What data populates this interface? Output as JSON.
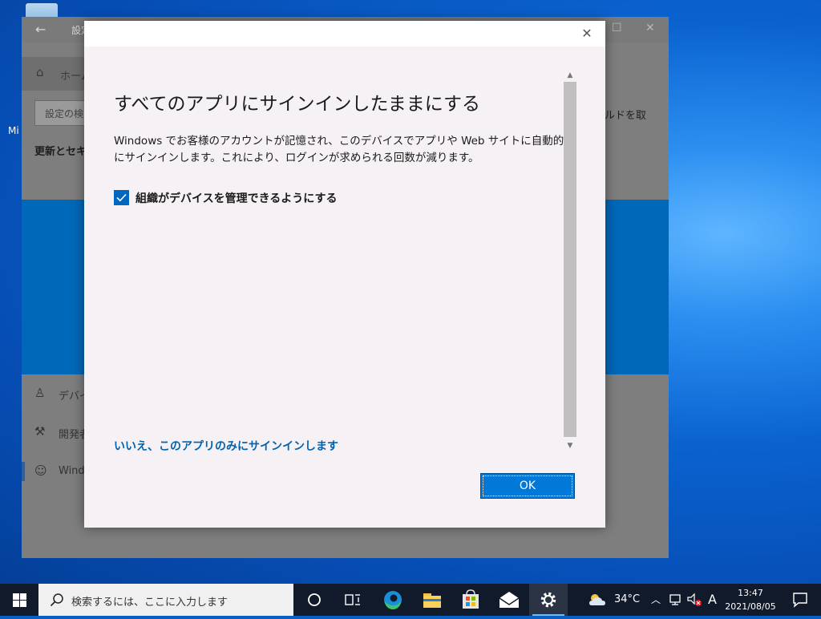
{
  "desktop": {
    "icon_label": "Mi"
  },
  "settings": {
    "title": "設定",
    "home_label": "ホーム",
    "search_placeholder": "設定の検",
    "section_title": "更新とセキ",
    "right_text": "ルドを取",
    "nav": [
      "デバイ",
      "開発者",
      "Wind"
    ]
  },
  "dialog": {
    "title": "すべてのアプリにサインインしたままにする",
    "description": "Windows でお客様のアカウントが記憶され、このデバイスでアプリや Web サイトに自動的にサインインします。これにより、ログインが求められる回数が減ります。",
    "checkbox_label": "組織がデバイスを管理できるようにする",
    "checkbox_checked": true,
    "alt_link": "いいえ、このアプリのみにサインインします",
    "ok_label": "OK"
  },
  "taskbar": {
    "search_placeholder": "検索するには、ここに入力します",
    "weather_temp": "34°C",
    "ime_indicator": "A",
    "time": "13:47",
    "date": "2021/08/05",
    "accent": "#76b9ed"
  }
}
